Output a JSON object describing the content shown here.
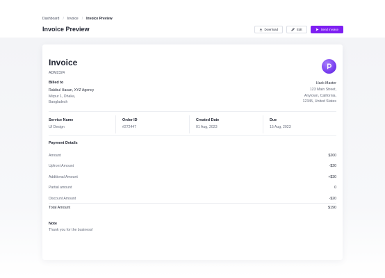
{
  "breadcrumb": {
    "items": [
      "Dashboard",
      "Invoice",
      "Invoice Preview"
    ]
  },
  "header": {
    "title": "Invoice Preview",
    "download_label": "Download",
    "edit_label": "Edit",
    "send_label": "Send Invoice",
    "icons": {
      "download": "download-icon",
      "edit": "pencil-icon",
      "send": "send-icon"
    }
  },
  "colors": {
    "accent": "#7e1ff2",
    "logo": "#7a3ff0"
  },
  "invoice": {
    "title": "Invoice",
    "id": "ADM2324",
    "logo_icon": "brand-logo-icon",
    "billed_to": {
      "label": "Billed to",
      "name": "Rakibul Hasan, XYZ Agency",
      "address_line1": "Mirpur 1, Dhaka,",
      "address_line2": "Bangladesh"
    },
    "from": {
      "name": "Hack Master",
      "address_line1": "123 Main Street,",
      "address_line2": "Anytown, California,",
      "address_line3": "12345, United States"
    },
    "meta": [
      {
        "label": "Service Name",
        "value": "UI Design"
      },
      {
        "label": "Order ID",
        "value": "#272447"
      },
      {
        "label": "Created Date",
        "value": "01 Aug, 2023"
      },
      {
        "label": "Due",
        "value": "15 Aug, 2023"
      }
    ],
    "payment_details": {
      "title": "Payment Details",
      "rows": [
        {
          "label": "Amount",
          "value": "$200"
        },
        {
          "label": "Upfront Amount",
          "value": "-$20"
        },
        {
          "label": "Additional Amount",
          "value": "+$30"
        },
        {
          "label": "Partial amount",
          "value": "0"
        },
        {
          "label": "Discount Amount",
          "value": "-$20"
        }
      ],
      "total_label": "Total Amount",
      "total_value": "$190"
    },
    "note": {
      "label": "Note",
      "text": "Thank you for the business!"
    }
  }
}
